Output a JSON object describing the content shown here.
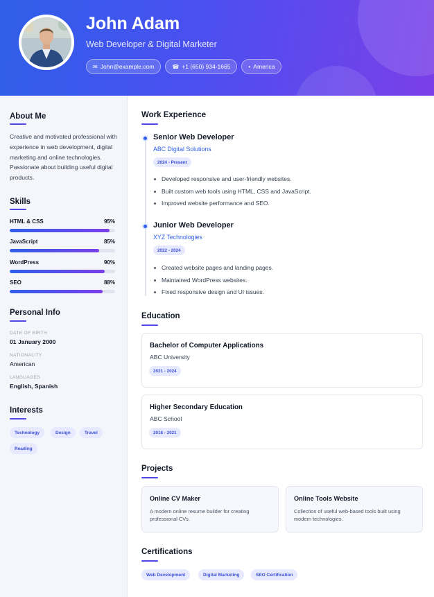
{
  "header": {
    "name": "John Adam",
    "role": "Web Developer & Digital Marketer",
    "email": "John@example.com",
    "phone": "+1 (650) 934-1665",
    "location": "America",
    "email_icon": "mail-icon",
    "phone_icon": "phone-icon",
    "location_icon": "pin-icon"
  },
  "about": {
    "title": "About Me",
    "text": "Creative and motivated professional with experience in web development, digital marketing and online technologies. Passionate about building useful digital products."
  },
  "skills": {
    "title": "Skills",
    "items": [
      {
        "name": "HTML & CSS",
        "percent": "95%",
        "level": 95
      },
      {
        "name": "JavaScript",
        "percent": "85%",
        "level": 85
      },
      {
        "name": "WordPress",
        "percent": "90%",
        "level": 90
      },
      {
        "name": "SEO",
        "percent": "88%",
        "level": 88
      }
    ]
  },
  "personal": {
    "title": "Personal Info",
    "items": [
      {
        "label": "DATE OF BIRTH",
        "value": "01 January 2000"
      },
      {
        "label": "NATIONALITY",
        "value": "American"
      },
      {
        "label": "LANGUAGES",
        "value": "English, Spanish"
      }
    ]
  },
  "interests": {
    "title": "Interests",
    "items": [
      "Technology",
      "Design",
      "Travel",
      "Reading"
    ]
  },
  "work": {
    "title": "Work Experience",
    "jobs": [
      {
        "title": "Senior Web Developer",
        "company": "ABC Digital Solutions",
        "dates": "2024 - Present",
        "bullets": [
          "Developed responsive and user-friendly websites.",
          "Built custom web tools using HTML, CSS and JavaScript.",
          "Improved website performance and SEO."
        ]
      },
      {
        "title": "Junior Web Developer",
        "company": "XYZ Technologies",
        "dates": "2022 - 2024",
        "bullets": [
          "Created website pages and landing pages.",
          "Maintained WordPress websites.",
          "Fixed responsive design and UI issues."
        ]
      }
    ]
  },
  "education": {
    "title": "Education",
    "items": [
      {
        "degree": "Bachelor of Computer Applications",
        "school": "ABC University",
        "dates": "2021 - 2024"
      },
      {
        "degree": "Higher Secondary Education",
        "school": "ABC School",
        "dates": "2018 - 2021"
      }
    ]
  },
  "projects": {
    "title": "Projects",
    "items": [
      {
        "name": "Online CV Maker",
        "desc": "A modern online resume builder for creating professional CVs."
      },
      {
        "name": "Online Tools Website",
        "desc": "Collection of useful web-based tools built using modern technologies."
      }
    ]
  },
  "certifications": {
    "title": "Certifications",
    "items": [
      "Web Development",
      "Digital Marketing",
      "SEO Certification"
    ]
  },
  "colors": {
    "accent": "#2f5fe8",
    "accent_purple": "#7b3fe8",
    "tag_bg": "#e7eafe"
  }
}
